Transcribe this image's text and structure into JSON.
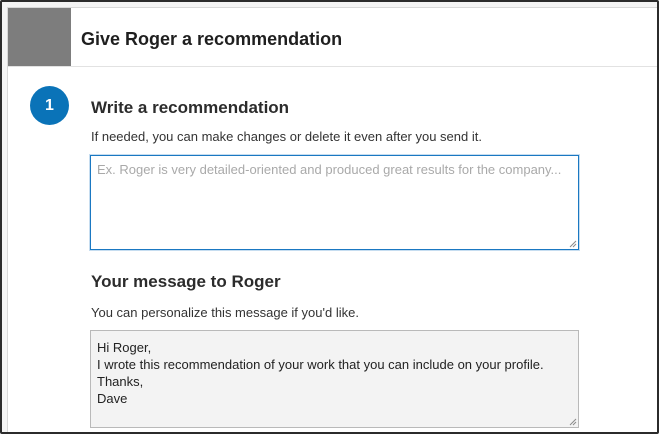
{
  "dialog": {
    "title": "Give Roger a recommendation"
  },
  "step": {
    "number": "1",
    "color": "#0a73b8"
  },
  "recommendation": {
    "heading": "Write a recommendation",
    "helper": "If needed, you can make changes or delete it even after you send it.",
    "placeholder": "Ex. Roger is very detailed-oriented and produced great results for the company...",
    "value": ""
  },
  "message": {
    "heading": "Your message to Roger",
    "helper": "You can personalize this message if you'd like.",
    "value": "Hi Roger,\nI wrote this recommendation of your work that you can include on your profile.\nThanks,\nDave"
  },
  "icons": {
    "avatar": "profile-photo-placeholder",
    "resize": "resize-grip-icon"
  }
}
